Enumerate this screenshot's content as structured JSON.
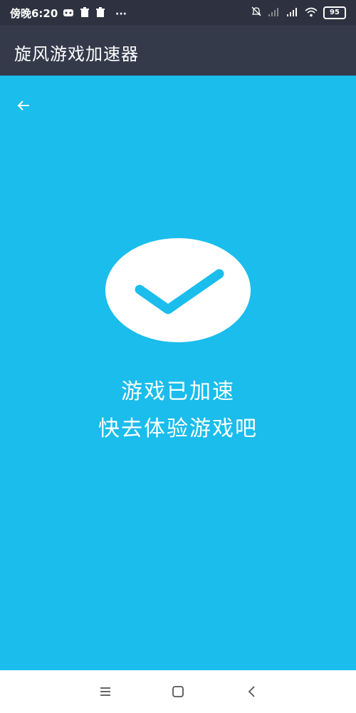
{
  "status_bar": {
    "time": "傍晚6:20",
    "more": "···",
    "battery_level": "95",
    "icons_left": [
      "gamepad-icon",
      "trash-icon",
      "trash-icon",
      "more-icon"
    ],
    "icons_right": [
      "bell-off-icon",
      "signal-weak-icon",
      "signal-icon",
      "wifi-icon",
      "battery-icon"
    ]
  },
  "app_bar": {
    "title": "旋风游戏加速器"
  },
  "content": {
    "back_icon": "arrow-left-icon",
    "success_icon": "checkmark-icon",
    "message_line1": "游戏已加速",
    "message_line2": "快去体验游戏吧"
  },
  "nav_bar": {
    "buttons": [
      "menu-icon",
      "home-square-icon",
      "back-chevron-icon"
    ]
  },
  "colors": {
    "status_bar_bg": "#2E3240",
    "app_bar_bg": "#353A4B",
    "content_bg": "#1ABDEC",
    "checkmark": "#1ABDEC",
    "nav_bar_bg": "#FFFFFF"
  }
}
